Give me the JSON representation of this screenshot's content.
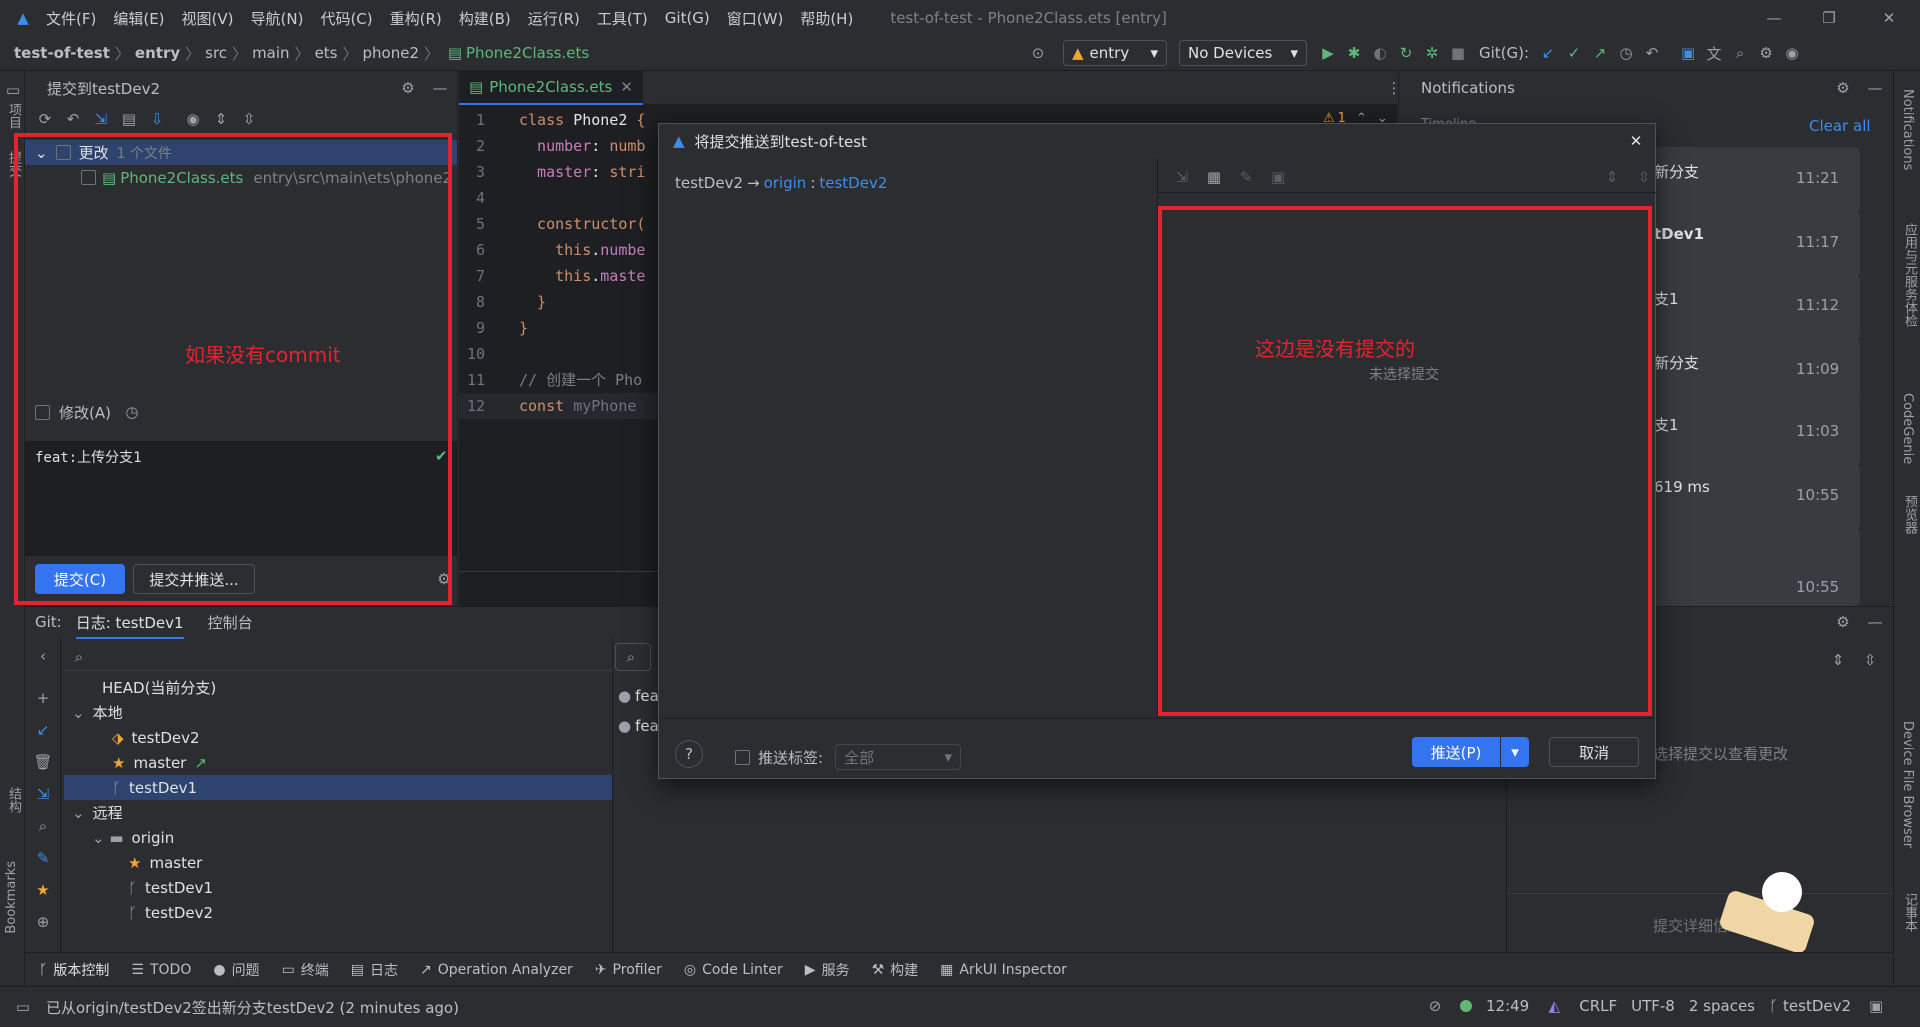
{
  "menu": {
    "items": [
      "文件(F)",
      "编辑(E)",
      "视图(V)",
      "导航(N)",
      "代码(C)",
      "重构(R)",
      "构建(B)",
      "运行(R)",
      "工具(T)",
      "Git(G)",
      "窗口(W)",
      "帮助(H)"
    ],
    "window_title": "test-of-test - Phone2Class.ets [entry]"
  },
  "nav": {
    "crumbs": [
      "test-of-test",
      "entry",
      "src",
      "main",
      "ets",
      "phone2"
    ],
    "file": "Phone2Class.ets",
    "run_config": "entry",
    "device": "No Devices",
    "git_label": "Git(G):"
  },
  "left_strip": {
    "project": "项目",
    "commit": "提交",
    "structure": "结构",
    "bookmarks": "Bookmarks"
  },
  "right_strip": {
    "notifications": "Notifications",
    "app_services": "应用与元服务体检",
    "codegenie": "CodeGenie",
    "preview": "预览器",
    "device_file_browser": "Device File Browser",
    "notes": "记事本"
  },
  "commit": {
    "title": "提交到testDev2",
    "group": "更改",
    "group_count": "1 个文件",
    "file_name": "Phone2Class.ets",
    "file_path": "entry\\src\\main\\ets\\phone2",
    "amend": "修改(A)",
    "message": "feat:上传分支1",
    "commit_btn": "提交(C)",
    "commit_push_btn": "提交并推送...",
    "annotation": "如果没有commit"
  },
  "editor": {
    "tab": "Phone2Class.ets",
    "warnings": "1",
    "lines": [
      {
        "n": "1",
        "parts": [
          [
            "kw",
            "class "
          ],
          [
            "cls",
            "Phone2 "
          ],
          [
            "kw",
            "{"
          ]
        ]
      },
      {
        "n": "2",
        "parts": [
          [
            "fld",
            "  number"
          ],
          [
            "cls",
            ": "
          ],
          [
            "kw",
            "numb"
          ]
        ]
      },
      {
        "n": "3",
        "parts": [
          [
            "fld",
            "  master"
          ],
          [
            "cls",
            ": "
          ],
          [
            "kw",
            "stri"
          ]
        ]
      },
      {
        "n": "4",
        "parts": []
      },
      {
        "n": "5",
        "parts": [
          [
            "kw",
            "  constructor("
          ]
        ]
      },
      {
        "n": "6",
        "parts": [
          [
            "kw",
            "    this"
          ],
          [
            "cls",
            "."
          ],
          [
            "fld",
            "numbe"
          ]
        ]
      },
      {
        "n": "7",
        "parts": [
          [
            "kw",
            "    this"
          ],
          [
            "cls",
            "."
          ],
          [
            "fld",
            "maste"
          ]
        ]
      },
      {
        "n": "8",
        "parts": [
          [
            "kw",
            "  }"
          ]
        ]
      },
      {
        "n": "9",
        "parts": [
          [
            "kw",
            "}"
          ]
        ]
      },
      {
        "n": "10",
        "parts": []
      },
      {
        "n": "11",
        "parts": [
          [
            "cm",
            "// 创建一个 Pho"
          ]
        ]
      },
      {
        "n": "12",
        "parts": [
          [
            "kw",
            "const "
          ],
          [
            "dim",
            "myPhone"
          ]
        ]
      }
    ]
  },
  "notifications": {
    "title": "Notifications",
    "timeline": "Timeline",
    "clear_all": "Clear all",
    "items": [
      {
        "text": "新分支",
        "time": "11:21"
      },
      {
        "text": "tDev1",
        "time": "11:17"
      },
      {
        "text": "支1",
        "time": "11:12"
      },
      {
        "text": "新分支",
        "time": "11:09"
      },
      {
        "text": "支1",
        "time": "11:03"
      },
      {
        "text": "619 ms",
        "time": "10:55"
      },
      {
        "text": "",
        "time": "10:55"
      }
    ]
  },
  "git": {
    "label": "Git:",
    "tabs": [
      "日志: testDev1",
      "控制台"
    ],
    "search_placeholder": "",
    "tree": {
      "head": "HEAD(当前分支)",
      "local": "本地",
      "local_branches": [
        "testDev2",
        "master",
        "testDev1"
      ],
      "remote": "远程",
      "origin": "origin",
      "remote_branches": [
        "master",
        "testDev1",
        "testDev2"
      ]
    },
    "log_rows": [
      "feat",
      "feat"
    ],
    "detail_hint": "选择提交以查看更改",
    "detail_hint2": "提交详细信息"
  },
  "dialog": {
    "title": "将提交推送到test-of-test",
    "src_branch": "testDev2",
    "arrow": "→",
    "remote": "origin",
    "sep": ":",
    "dst_branch": "testDev2",
    "no_commit_selected": "未选择提交",
    "annotation": "这边是没有提交的",
    "push_tags": "推送标签:",
    "tags_value": "全部",
    "push_btn": "推送(P)",
    "cancel_btn": "取消",
    "help": "?"
  },
  "toolwindows": [
    "版本控制",
    "TODO",
    "问题",
    "终端",
    "日志",
    "Operation Analyzer",
    "Profiler",
    "Code Linter",
    "服务",
    "构建",
    "ArkUI Inspector"
  ],
  "status": {
    "message": "已从origin/testDev2签出新分支testDev2 (2 minutes ago)",
    "time": "12:49",
    "line_sep": "CRLF",
    "encoding": "UTF-8",
    "indent": "2 spaces",
    "branch": "testDev2"
  },
  "colors": {
    "accent": "#3574f0",
    "red_annotation": "#e5232f",
    "selection": "#2e436e"
  }
}
